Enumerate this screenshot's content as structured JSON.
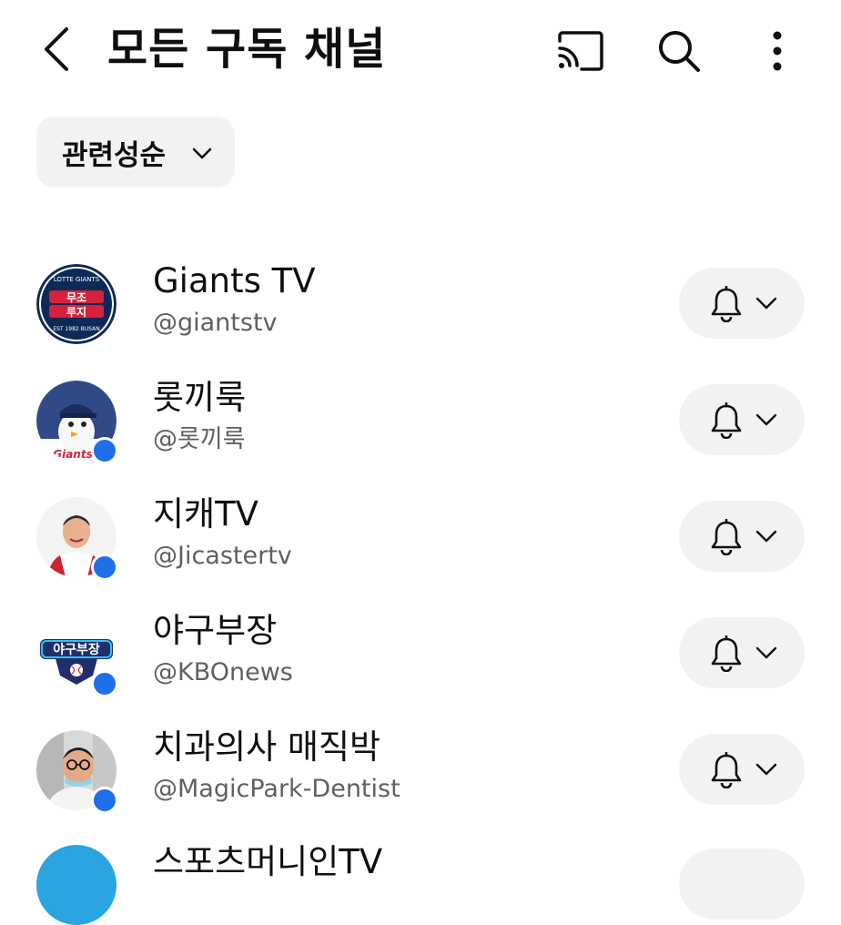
{
  "header": {
    "title": "모든 구독 채널",
    "back_icon": "chevron-left-icon",
    "cast_icon": "cast-icon",
    "search_icon": "search-icon",
    "more_icon": "more-vertical-icon"
  },
  "sort": {
    "label": "관련성순",
    "icon": "chevron-down-icon"
  },
  "colors": {
    "live_indicator": "#1f6feb",
    "chip_background": "#f2f2f2",
    "handle_text": "#606060"
  },
  "channels": [
    {
      "name": "Giants TV",
      "handle": "@giantstv",
      "avatar_text": "LOTTE GIANTS · 무조루지 · EST 1982 BUSAN",
      "live": false
    },
    {
      "name": "롯끼룩",
      "handle": "@롯끼룩",
      "avatar_text": "Giants",
      "live": true
    },
    {
      "name": "지캐TV",
      "handle": "@Jicastertv",
      "avatar_text": "",
      "live": true
    },
    {
      "name": "야구부장",
      "handle": "@KBOnews",
      "avatar_text": "야구부장",
      "live": true
    },
    {
      "name": "치과의사 매직박",
      "handle": "@MagicPark-Dentist",
      "avatar_text": "",
      "live": true
    }
  ],
  "partial_channel": {
    "name": "스포츠머니인TV"
  }
}
